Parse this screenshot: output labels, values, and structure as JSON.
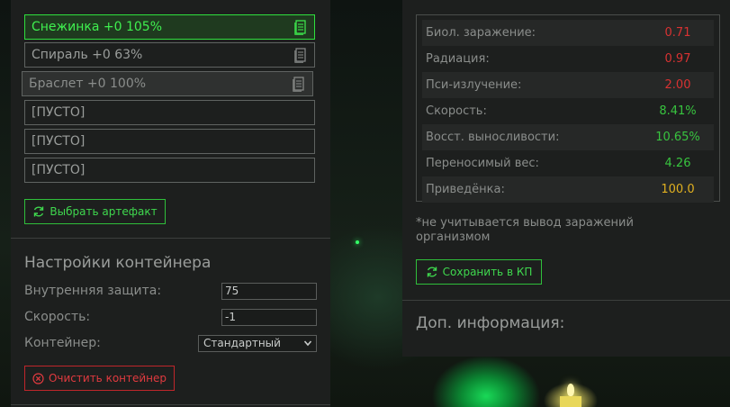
{
  "artifact_slots": [
    {
      "label": "Снежинка +0 105%",
      "state": "active",
      "has_icon": true
    },
    {
      "label": "Спираль +0 63%",
      "state": "normal",
      "has_icon": true
    },
    {
      "label": "Браслет +0 100%",
      "state": "dragging",
      "has_icon": true
    },
    {
      "label": "[ПУСТО]",
      "state": "empty",
      "has_icon": false
    },
    {
      "label": "[ПУСТО]",
      "state": "empty",
      "has_icon": false
    },
    {
      "label": "[ПУСТО]",
      "state": "empty",
      "has_icon": false
    }
  ],
  "select_artifact_button": "Выбрать артефакт",
  "container_settings": {
    "title": "Настройки контейнера",
    "inner_protection_label": "Внутренняя защита:",
    "inner_protection_value": "75",
    "speed_label": "Скорость:",
    "speed_value": "-1",
    "container_label": "Контейнер:",
    "container_selected": "Стандартный",
    "clear_button": "Очистить контейнер"
  },
  "stats": [
    {
      "name": "Биол. заражение:",
      "value": "0.71",
      "color": "#d83232"
    },
    {
      "name": "Радиация:",
      "value": "0.97",
      "color": "#d83232"
    },
    {
      "name": "Пси-излучение:",
      "value": "2.00",
      "color": "#d83232"
    },
    {
      "name": "Скорость:",
      "value": "8.41%",
      "color": "#38c43f"
    },
    {
      "name": "Восст. выносливости:",
      "value": "10.65%",
      "color": "#38c43f"
    },
    {
      "name": "Переносимый вес:",
      "value": "4.26",
      "color": "#38c43f"
    },
    {
      "name": "Приведёнка:",
      "value": "100.0",
      "color": "#e0b020"
    }
  ],
  "stats_note": "*не учитывается вывод заражений организмом",
  "save_button": "Сохранить в КП",
  "extra_info_title": "Доп. информация:",
  "colors": {
    "accent_green": "#2fe03d",
    "danger_red": "#c0262b",
    "neutral_yellow": "#e0b020"
  },
  "icons": {
    "slot_icon": "document-icon",
    "button_icon": "refresh-icon",
    "clear_icon": "cancel-circle-icon",
    "select_icon": "chevron-down-icon"
  }
}
